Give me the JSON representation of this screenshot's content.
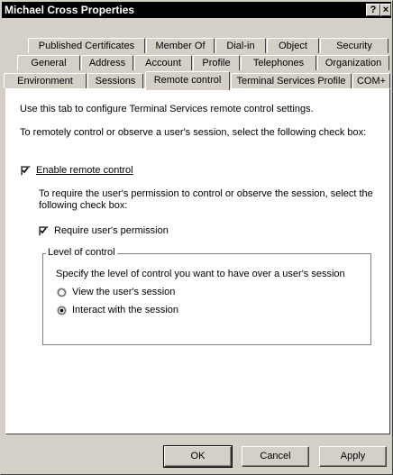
{
  "window": {
    "title": "Michael Cross Properties",
    "help_glyph": "?",
    "close_glyph": "×"
  },
  "tabs": {
    "row1": [
      "Published Certificates",
      "Member Of",
      "Dial-in",
      "Object",
      "Security"
    ],
    "row2": [
      "General",
      "Address",
      "Account",
      "Profile",
      "Telephones",
      "Organization"
    ],
    "row3": [
      "Environment",
      "Sessions",
      "Remote control",
      "Terminal Services Profile",
      "COM+"
    ],
    "active": "Remote control"
  },
  "content": {
    "intro": "Use this tab to configure Terminal Services remote control settings.",
    "instructions": "To remotely control or observe a user's session, select the following check box:",
    "enable_remote_control": {
      "label": "Enable remote control",
      "checked": true
    },
    "permission_instructions": "To require the user's permission to control or observe the session, select the following check box:",
    "require_permission": {
      "label": "Require user's permission",
      "checked": true
    },
    "level_group": {
      "title": "Level of control",
      "description": "Specify the level of control you want to have over a user's session",
      "options": [
        {
          "label": "View the user's session",
          "selected": false
        },
        {
          "label": "Interact with the session",
          "selected": true
        }
      ]
    }
  },
  "buttons": {
    "ok": "OK",
    "cancel": "Cancel",
    "apply": "Apply"
  }
}
